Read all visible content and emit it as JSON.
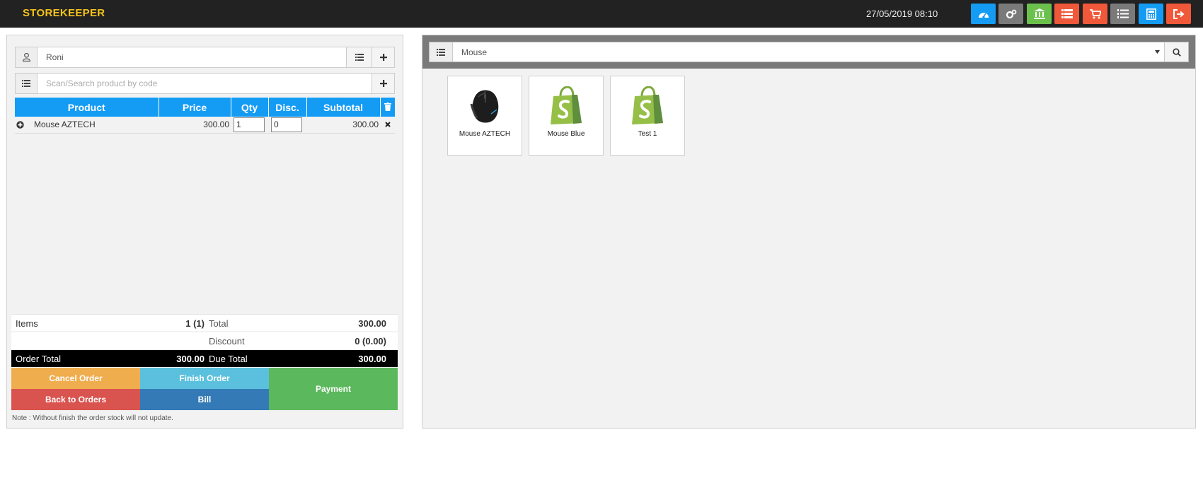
{
  "header": {
    "brand": "STOREKEEPER",
    "datetime": "27/05/2019 08:10",
    "buttons": [
      {
        "name": "dashboard",
        "color": "#149cf5"
      },
      {
        "name": "settings",
        "color": "#7a7a7a"
      },
      {
        "name": "bank",
        "color": "#6cc14d"
      },
      {
        "name": "list",
        "color": "#f0583a"
      },
      {
        "name": "cart",
        "color": "#f0583a"
      },
      {
        "name": "ordered-list",
        "color": "#7a7a7a"
      },
      {
        "name": "calculator",
        "color": "#149cf5"
      },
      {
        "name": "logout",
        "color": "#f0583a"
      }
    ]
  },
  "order": {
    "customer_value": "Roni",
    "search_placeholder": "Scan/Search product by code",
    "columns": {
      "product": "Product",
      "price": "Price",
      "qty": "Qty",
      "disc": "Disc.",
      "subtotal": "Subtotal"
    },
    "items": [
      {
        "product": "Mouse AZTECH",
        "price": "300.00",
        "qty": "1",
        "disc": "0",
        "subtotal": "300.00"
      }
    ],
    "totals": {
      "items_label": "Items",
      "items_value": "1 (1)",
      "total_label": "Total",
      "total_value": "300.00",
      "discount_label": "Discount",
      "discount_value": "0 (0.00)",
      "order_total_label": "Order Total",
      "order_total_value": "300.00",
      "due_total_label": "Due Total",
      "due_total_value": "300.00"
    },
    "actions": {
      "cancel": "Cancel Order",
      "finish": "Finish Order",
      "payment": "Payment",
      "back": "Back to Orders",
      "bill": "Bill"
    },
    "note": "Note : Without finish the order stock will not update."
  },
  "catalog": {
    "category_value": "Mouse",
    "products": [
      {
        "label": "Mouse AZTECH",
        "image": "mouse-image"
      },
      {
        "label": "Mouse Blue",
        "image": "shopify-bag-image"
      },
      {
        "label": "Test 1",
        "image": "shopify-bag-image"
      }
    ]
  },
  "colors": {
    "accent": "#149cf5",
    "cancel": "#f0ad4e",
    "finish": "#5bc0de",
    "payment": "#5cb85c",
    "back": "#d9534f",
    "bill": "#337ab7"
  }
}
